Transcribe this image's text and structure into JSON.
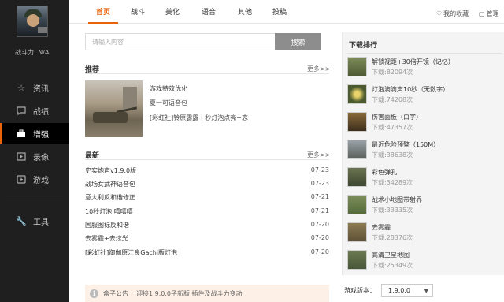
{
  "sidebar": {
    "power_label": "战斗力: N/A",
    "items": [
      {
        "label": "资讯",
        "icon": "star-icon"
      },
      {
        "label": "战绩",
        "icon": "comment-icon"
      },
      {
        "label": "增强",
        "icon": "briefcase-icon",
        "active": true
      },
      {
        "label": "录像",
        "icon": "video-icon"
      },
      {
        "label": "游戏",
        "icon": "gamepad-icon"
      },
      {
        "label": "工具",
        "icon": "wrench-icon"
      }
    ]
  },
  "tabs": [
    "首页",
    "战斗",
    "美化",
    "语音",
    "其他",
    "投稿"
  ],
  "active_tab": "首页",
  "header": {
    "favorites": "我的收藏",
    "manage": "管理"
  },
  "search": {
    "placeholder": "请输入内容",
    "button": "搜索"
  },
  "recommend": {
    "title": "推荐",
    "more": "更多>>",
    "items": [
      "游戏特效优化",
      "夏一可语音包",
      "[彩虹社]铃原露露十秒灯泡点亮+恋"
    ]
  },
  "latest": {
    "title": "最新",
    "more": "更多>>",
    "items": [
      {
        "title": "史实炮声v1.9.0版",
        "date": "07-23"
      },
      {
        "title": "战场女武神语音包",
        "date": "07-23"
      },
      {
        "title": "意大利反和谐修正",
        "date": "07-21"
      },
      {
        "title": "10秒灯泡 嘻嘻嘻",
        "date": "07-21"
      },
      {
        "title": "国服图标反和谐",
        "date": "07-20"
      },
      {
        "title": "去雾霾+去炫光",
        "date": "07-20"
      },
      {
        "title": "[彩虹社]御伽原江良Gachi版灯泡",
        "date": "07-20"
      }
    ]
  },
  "notice": {
    "label": "盒子公告",
    "text": "迎接1.9.0.0子新版 插件及战斗力变动"
  },
  "ranking": {
    "title": "下载排行",
    "items": [
      {
        "name": "解锁视距+30倍开镜（记忆）",
        "downloads": "下载:82094次"
      },
      {
        "name": "灯泡滴滴声10秒（无数字）",
        "downloads": "下载:74208次"
      },
      {
        "name": "伤害面板（白字）",
        "downloads": "下载:47357次"
      },
      {
        "name": "最近危险预警（150M）",
        "downloads": "下载:38638次"
      },
      {
        "name": "彩色弹孔",
        "downloads": "下载:34289次"
      },
      {
        "name": "战术小地图带射界",
        "downloads": "下载:33335次"
      },
      {
        "name": "去雾霾",
        "downloads": "下载:28376次"
      },
      {
        "name": "高清卫星地图",
        "downloads": "下载:25349次"
      }
    ]
  },
  "version": {
    "label": "游戏版本：",
    "selected": "1.9.0.0"
  },
  "colors": {
    "accent": "#e8630a",
    "sidebar_bg": "#1f1f1f",
    "search_button": "#8d8d8d"
  }
}
